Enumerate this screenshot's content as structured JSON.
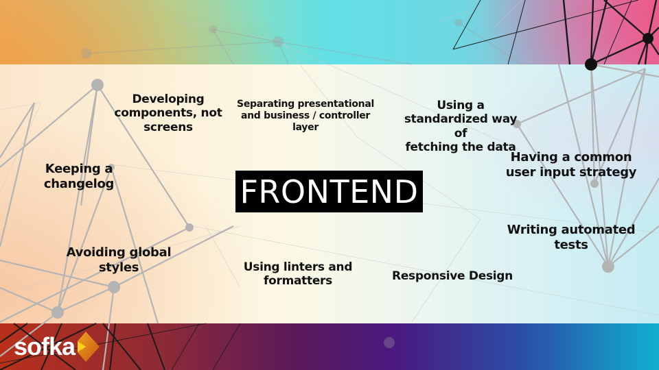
{
  "slide": {
    "title": "FRONTEND",
    "topics": [
      {
        "id": "developing-components",
        "lines": [
          "Developing",
          "components, not",
          "screens"
        ]
      },
      {
        "id": "separating-layers",
        "lines": [
          "Separating presentational",
          "and business / controller",
          "layer"
        ]
      },
      {
        "id": "standardized-fetching",
        "lines": [
          "Using a",
          "standardized way of",
          "fetching the data"
        ]
      },
      {
        "id": "keeping-changelog",
        "lines": [
          "Keeping a",
          "changelog"
        ]
      },
      {
        "id": "common-input-strategy",
        "lines": [
          "Having a common",
          "user input strategy"
        ]
      },
      {
        "id": "automated-tests",
        "lines": [
          "Writing automated",
          "tests"
        ]
      },
      {
        "id": "avoiding-global-styles",
        "lines": [
          "Avoiding global",
          "styles"
        ]
      },
      {
        "id": "linters-formatters",
        "lines": [
          "Using linters and",
          "formatters"
        ]
      },
      {
        "id": "responsive-design",
        "lines": [
          "Responsive Design"
        ]
      }
    ]
  },
  "brand": {
    "logo_text": "sofka",
    "logo_mark_colors": [
      "#f0a020",
      "#e06a10",
      "#ffd020"
    ]
  },
  "colors": {
    "title_bg": "#000000",
    "title_fg": "#ffffff",
    "text": "#111111"
  }
}
